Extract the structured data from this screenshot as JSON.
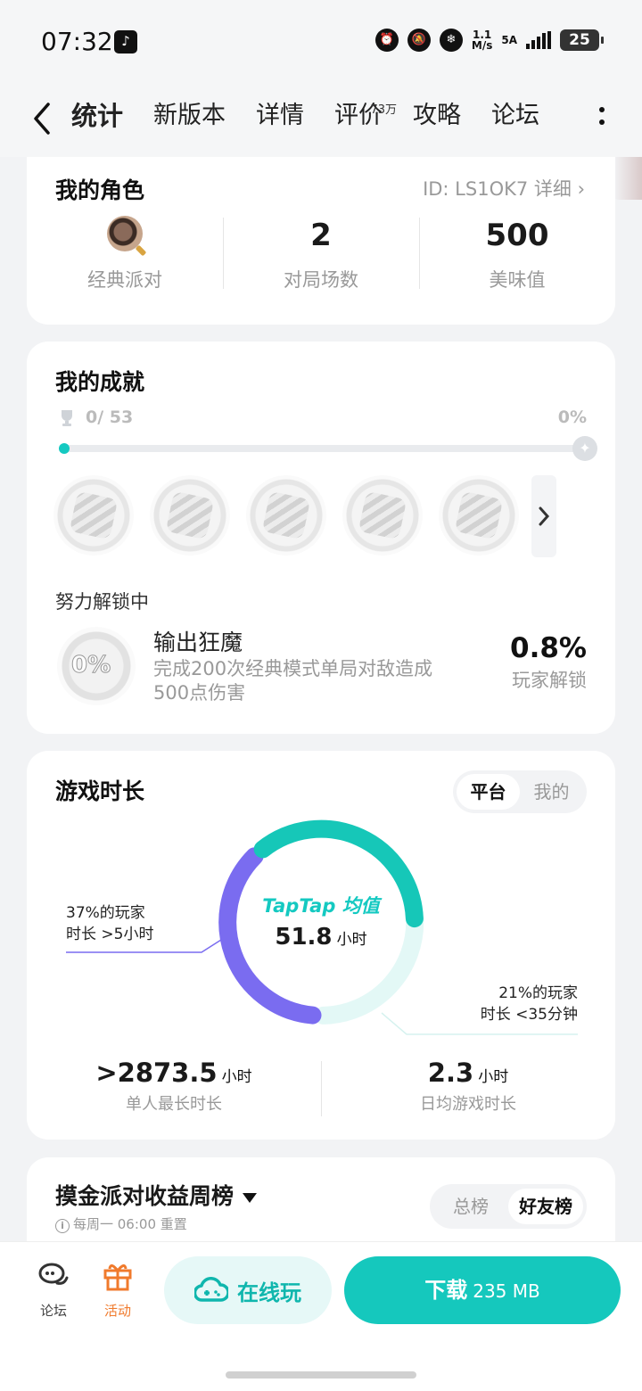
{
  "status_bar": {
    "time": "07:32",
    "net_speed_value": "1.1",
    "net_speed_unit": "M/s",
    "network": "5A",
    "battery": "25"
  },
  "tabs": [
    {
      "label": "统计",
      "active": true
    },
    {
      "label": "新版本"
    },
    {
      "label": "详情"
    },
    {
      "label": "评价",
      "badge": "73万"
    },
    {
      "label": "攻略"
    },
    {
      "label": "论坛"
    }
  ],
  "role": {
    "title": "我的角色",
    "id_text": "ID: LS1OK7 详细",
    "cols": [
      {
        "value": "",
        "label": "经典派对",
        "icon": "magnifier-icon"
      },
      {
        "value": "2",
        "label": "对局场数"
      },
      {
        "value": "500",
        "label": "美味值"
      }
    ]
  },
  "achievements": {
    "title": "我的成就",
    "count": "0/ 53",
    "percent": "0%",
    "progress": 0,
    "unlocking_title": "努力解锁中",
    "badge_overlay": "0%",
    "current": {
      "name": "输出狂魔",
      "desc": "完成200次经典模式单局对敌造成500点伤害",
      "rate": "0.8%",
      "rate_label": "玩家解锁"
    }
  },
  "playtime": {
    "title": "游戏时长",
    "seg": [
      "平台",
      "我的"
    ],
    "brand": "TapTap 均值",
    "avg_value": "51.8",
    "avg_unit": "小时",
    "note_left_l1": "37%的玩家",
    "note_left_l2": "时长 >5小时",
    "note_right_l1": "21%的玩家",
    "note_right_l2": "时长 <35分钟",
    "max_value": ">2873.5",
    "max_unit": "小时",
    "max_label": "单人最长时长",
    "daily_value": "2.3",
    "daily_unit": "小时",
    "daily_label": "日均游戏时长",
    "colors": {
      "long": "#7a6cf0",
      "mid": "#16c7b8",
      "short": "#e3f8f6"
    }
  },
  "ranking": {
    "title": "摸金派对收益周榜",
    "sub": "每周一 06:00 重置",
    "seg": [
      "总榜",
      "好友榜"
    ]
  },
  "bottom": {
    "forum": "论坛",
    "activity": "活动",
    "online": "在线玩",
    "download": "下载",
    "size": "235 MB"
  },
  "accent": "#14c9c1"
}
